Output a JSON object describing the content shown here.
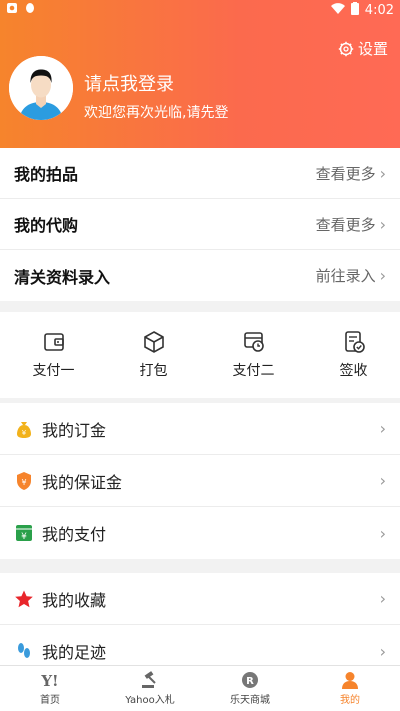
{
  "status_bar": {
    "time": "4:02"
  },
  "header": {
    "settings_label": "设置",
    "login_title": "请点我登录",
    "login_subtitle": "欢迎您再次光临,请先登"
  },
  "sections": [
    {
      "title": "我的拍品",
      "action": "查看更多"
    },
    {
      "title": "我的代购",
      "action": "查看更多"
    },
    {
      "title": "清关资料录入",
      "action": "前往录入"
    }
  ],
  "quick_actions": [
    {
      "label": "支付一",
      "icon": "wallet-icon"
    },
    {
      "label": "打包",
      "icon": "package-box-icon"
    },
    {
      "label": "支付二",
      "icon": "pay-clock-icon"
    },
    {
      "label": "签收",
      "icon": "receipt-check-icon"
    }
  ],
  "menu_group1": [
    {
      "label": "我的订金",
      "icon": "money-bag-icon",
      "color": "#f2b21b"
    },
    {
      "label": "我的保证金",
      "icon": "shield-yen-icon",
      "color": "#f6842c"
    },
    {
      "label": "我的支付",
      "icon": "yen-card-icon",
      "color": "#2aa04a"
    }
  ],
  "menu_group2": [
    {
      "label": "我的收藏",
      "icon": "star-icon",
      "color": "#e8262b"
    },
    {
      "label": "我的足迹",
      "icon": "footprints-icon",
      "color": "#3a9bdc"
    }
  ],
  "tabs": [
    {
      "label": "首页",
      "icon": "yahoo-icon"
    },
    {
      "label": "Yahoo入札",
      "icon": "gavel-icon"
    },
    {
      "label": "乐天商城",
      "icon": "rakuten-icon"
    },
    {
      "label": "我的",
      "icon": "person-icon",
      "active": true
    }
  ],
  "colors": {
    "accent": "#f6842c"
  }
}
